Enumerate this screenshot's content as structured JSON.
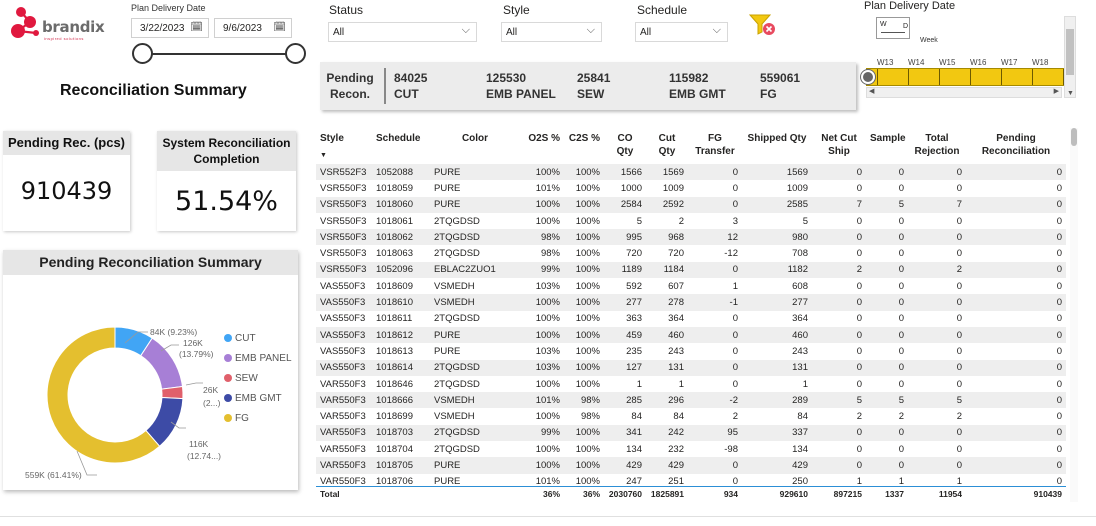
{
  "logo": {
    "text": "brandix",
    "subtitle": "inspired solutions"
  },
  "date_slicer": {
    "label": "Plan Delivery Date",
    "start": "3/22/2023",
    "end": "9/6/2023"
  },
  "filters": {
    "status": {
      "label": "Status",
      "value": "All"
    },
    "style": {
      "label": "Style",
      "value": "All"
    },
    "schedule": {
      "label": "Schedule",
      "value": "All"
    }
  },
  "week_slicer": {
    "title": "Plan Delivery Date",
    "mini_labels": [
      "W",
      "D"
    ],
    "level_label": "Week",
    "weeks": [
      "W13",
      "W14",
      "W15",
      "W16",
      "W17",
      "W18"
    ]
  },
  "pending_card": {
    "title": "Pending Recon.",
    "items": [
      {
        "value": "84025",
        "label": "CUT"
      },
      {
        "value": "125530",
        "label": "EMB PANEL"
      },
      {
        "value": "25841",
        "label": "SEW"
      },
      {
        "value": "115982",
        "label": "EMB GMT"
      },
      {
        "value": "559061",
        "label": "FG"
      }
    ]
  },
  "page_title": "Reconciliation Summary",
  "kpi_pending": {
    "title": "Pending Rec. (pcs)",
    "value": "910439"
  },
  "kpi_completion": {
    "title": "System Reconciliation Completion",
    "value": "51.54%"
  },
  "donut": {
    "title": "Pending Reconciliation Summary",
    "legend": [
      "CUT",
      "EMB PANEL",
      "SEW",
      "EMB GMT",
      "FG"
    ],
    "labels": [
      "84K (9.23%)",
      "126K",
      "(13.79%)",
      "26K",
      "(2...)",
      "116K",
      "(12.74...)",
      "559K (61.41%)"
    ]
  },
  "chart_data": {
    "type": "pie",
    "title": "Pending Reconciliation Summary",
    "categories": [
      "CUT",
      "EMB PANEL",
      "SEW",
      "EMB GMT",
      "FG"
    ],
    "values": [
      84025,
      125530,
      25841,
      115982,
      559061
    ],
    "colors": [
      "#41a5f5",
      "#a77fd6",
      "#e0606b",
      "#3d4ba6",
      "#e4bf2f"
    ],
    "legend_position": "right",
    "donut": true
  },
  "table": {
    "headers": [
      "Style",
      "Schedule",
      "Color",
      "O2S %",
      "C2S %",
      "CO Qty",
      "Cut Qty",
      "FG Transfer",
      "Shipped Qty",
      "Net Cut Ship",
      "Sample",
      "Total Rejection",
      "Pending Reconciliation"
    ],
    "rows": [
      [
        "VSR552F3",
        "1052088",
        "PURE",
        "100%",
        "100%",
        "1566",
        "1569",
        "0",
        "1569",
        "0",
        "0",
        "0",
        "0"
      ],
      [
        "VSR550F3",
        "1018059",
        "PURE",
        "101%",
        "100%",
        "1000",
        "1009",
        "0",
        "1009",
        "0",
        "0",
        "0",
        "0"
      ],
      [
        "VSR550F3",
        "1018060",
        "PURE",
        "100%",
        "100%",
        "2584",
        "2592",
        "0",
        "2585",
        "7",
        "5",
        "7",
        "0"
      ],
      [
        "VSR550F3",
        "1018061",
        "2TQGDSD",
        "100%",
        "100%",
        "5",
        "2",
        "3",
        "5",
        "0",
        "0",
        "0",
        "0"
      ],
      [
        "VSR550F3",
        "1018062",
        "2TQGDSD",
        "98%",
        "100%",
        "995",
        "968",
        "12",
        "980",
        "0",
        "0",
        "0",
        "0"
      ],
      [
        "VSR550F3",
        "1018063",
        "2TQGDSD",
        "98%",
        "100%",
        "720",
        "720",
        "-12",
        "708",
        "0",
        "0",
        "0",
        "0"
      ],
      [
        "VSR550F3",
        "1052096",
        "EBLAC2ZUO1",
        "99%",
        "100%",
        "1189",
        "1184",
        "0",
        "1182",
        "2",
        "0",
        "2",
        "0"
      ],
      [
        "VAS550F3",
        "1018609",
        "VSMEDH",
        "103%",
        "100%",
        "592",
        "607",
        "1",
        "608",
        "0",
        "0",
        "0",
        "0"
      ],
      [
        "VAS550F3",
        "1018610",
        "VSMEDH",
        "100%",
        "100%",
        "277",
        "278",
        "-1",
        "277",
        "0",
        "0",
        "0",
        "0"
      ],
      [
        "VAS550F3",
        "1018611",
        "2TQGDSD",
        "100%",
        "100%",
        "363",
        "364",
        "0",
        "364",
        "0",
        "0",
        "0",
        "0"
      ],
      [
        "VAS550F3",
        "1018612",
        "PURE",
        "100%",
        "100%",
        "459",
        "460",
        "0",
        "460",
        "0",
        "0",
        "0",
        "0"
      ],
      [
        "VAS550F3",
        "1018613",
        "PURE",
        "103%",
        "100%",
        "235",
        "243",
        "0",
        "243",
        "0",
        "0",
        "0",
        "0"
      ],
      [
        "VAS550F3",
        "1018614",
        "2TQGDSD",
        "103%",
        "100%",
        "127",
        "131",
        "0",
        "131",
        "0",
        "0",
        "0",
        "0"
      ],
      [
        "VAR550F3",
        "1018646",
        "2TQGDSD",
        "100%",
        "100%",
        "1",
        "1",
        "0",
        "1",
        "0",
        "0",
        "0",
        "0"
      ],
      [
        "VAR550F3",
        "1018666",
        "VSMEDH",
        "101%",
        "98%",
        "285",
        "296",
        "-2",
        "289",
        "5",
        "5",
        "5",
        "0"
      ],
      [
        "VAR550F3",
        "1018699",
        "VSMEDH",
        "100%",
        "98%",
        "84",
        "84",
        "2",
        "84",
        "2",
        "2",
        "2",
        "0"
      ],
      [
        "VAR550F3",
        "1018703",
        "2TQGDSD",
        "99%",
        "100%",
        "341",
        "242",
        "95",
        "337",
        "0",
        "0",
        "0",
        "0"
      ],
      [
        "VAR550F3",
        "1018704",
        "2TQGDSD",
        "100%",
        "100%",
        "134",
        "232",
        "-98",
        "134",
        "0",
        "0",
        "0",
        "0"
      ],
      [
        "VAR550F3",
        "1018705",
        "PURE",
        "100%",
        "100%",
        "429",
        "429",
        "0",
        "429",
        "0",
        "0",
        "0",
        "0"
      ],
      [
        "VAR550F3",
        "1018706",
        "PURE",
        "101%",
        "100%",
        "247",
        "251",
        "0",
        "250",
        "1",
        "1",
        "1",
        "0"
      ]
    ],
    "total": [
      "Total",
      "",
      "",
      "36%",
      "36%",
      "2030760",
      "1825891",
      "934",
      "929610",
      "897215",
      "1337",
      "11954",
      "910439"
    ]
  }
}
